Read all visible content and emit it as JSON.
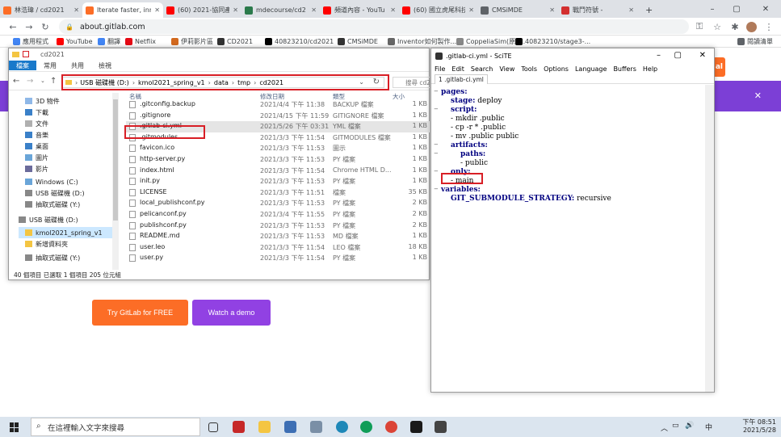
{
  "browser": {
    "tabs": [
      {
        "label": "林浩瑋 / cd2021",
        "icon": "gitlab-icon",
        "color": "#fc6d26"
      },
      {
        "label": "Iterate faster, inn",
        "icon": "gitlab-icon",
        "color": "#fc6d26"
      },
      {
        "label": "(60) 2021-協同產",
        "icon": "youtube-icon",
        "color": "#ff0000"
      },
      {
        "label": "mdecourse/cd2",
        "icon": "github-repo-icon",
        "color": "#2b7a4b"
      },
      {
        "label": "頻道內容 - YouTu",
        "icon": "youtube-icon",
        "color": "#ff0000"
      },
      {
        "label": "(60) 國立虎尾科技",
        "icon": "youtube-icon",
        "color": "#ff0000"
      },
      {
        "label": "CMSiMDE",
        "icon": "globe-icon",
        "color": "#5f6368"
      },
      {
        "label": "戰鬥符號 - ",
        "icon": "bookmark-icon",
        "color": "#d32f2f"
      }
    ],
    "new_tab": "+",
    "url": "about.gitlab.com",
    "bookmarks": [
      {
        "label": "應用程式",
        "color": "#4285f4"
      },
      {
        "label": "YouTube",
        "color": "#ff0000"
      },
      {
        "label": "翻譯",
        "color": "#4285f4"
      },
      {
        "label": "Netflix",
        "color": "#e50914"
      },
      {
        "label": "伊莉影片區",
        "color": "#d2691e"
      },
      {
        "label": "CD2021",
        "color": "#333333"
      },
      {
        "label": "40823210/cd2021",
        "color": "#000000"
      },
      {
        "label": "CMSiMDE",
        "color": "#333333"
      },
      {
        "label": "Inventor如何製作...",
        "color": "#666666"
      },
      {
        "label": "CoppeliaSim(原V...",
        "color": "#888888"
      },
      {
        "label": "40823210/stage3-...",
        "color": "#000000"
      },
      {
        "label": "閱讀清單",
        "color": "#5f6368"
      }
    ],
    "orange_btn_label": "al",
    "purple_bar_close": "✕"
  },
  "gitlab": {
    "try_button": "Try GitLab for FREE",
    "demo_button": "Watch a demo"
  },
  "explorer": {
    "title": "cd2021",
    "ribbon": [
      "檔案",
      "常用",
      "共用",
      "檢視"
    ],
    "breadcrumb": [
      "USB 磁碟機 (D:)",
      "kmol2021_spring_v1",
      "data",
      "tmp",
      "cd2021"
    ],
    "search_placeholder": "搜尋 cd2021",
    "columns": {
      "name": "名稱",
      "date": "修改日期",
      "type": "類型",
      "size": "大小"
    },
    "tree": [
      {
        "label": "3D 物件",
        "color": "#8fb8e8"
      },
      {
        "label": "下載",
        "color": "#3a80c8"
      },
      {
        "label": "文件",
        "color": "#b0b0b0"
      },
      {
        "label": "音樂",
        "color": "#3a80c8"
      },
      {
        "label": "桌面",
        "color": "#3a80c8"
      },
      {
        "label": "圖片",
        "color": "#6aa5d8"
      },
      {
        "label": "影片",
        "color": "#6b6b9b"
      },
      {
        "label": "Windows (C:)",
        "color": "#6aa5d8"
      },
      {
        "label": "USB 磁碟機 (D:)",
        "color": "#888888"
      },
      {
        "label": "抽取式磁碟 (Y:)",
        "color": "#888888"
      },
      {
        "label": "USB 磁碟機 (D:)",
        "color": "#888888"
      },
      {
        "label": "kmol2021_spring_v1",
        "color": "#f4c542"
      },
      {
        "label": "新增資料夾",
        "color": "#f4c542"
      },
      {
        "label": "抽取式磁碟 (Y:)",
        "color": "#888888"
      }
    ],
    "files": [
      {
        "name": ".gitconfig.backup",
        "date": "2021/4/4 下午 11:38",
        "type": "BACKUP 檔案",
        "size": "1 KB"
      },
      {
        "name": ".gitignore",
        "date": "2021/4/15 下午 11:59",
        "type": "GITIGNORE 檔案",
        "size": "1 KB"
      },
      {
        "name": ".gitlab-ci.yml",
        "date": "2021/5/26 下午 03:31",
        "type": "YML 檔案",
        "size": "1 KB"
      },
      {
        "name": ".gitmodules",
        "date": "2021/3/3 下午 11:54",
        "type": "GITMODULES 檔案",
        "size": "1 KB"
      },
      {
        "name": "favicon.ico",
        "date": "2021/3/3 下午 11:53",
        "type": "圖示",
        "size": "1 KB"
      },
      {
        "name": "http-server.py",
        "date": "2021/3/3 下午 11:53",
        "type": "PY 檔案",
        "size": "1 KB"
      },
      {
        "name": "index.html",
        "date": "2021/3/3 下午 11:54",
        "type": "Chrome HTML D...",
        "size": "1 KB"
      },
      {
        "name": "init.py",
        "date": "2021/3/3 下午 11:53",
        "type": "PY 檔案",
        "size": "1 KB"
      },
      {
        "name": "LICENSE",
        "date": "2021/3/3 下午 11:51",
        "type": "檔案",
        "size": "35 KB"
      },
      {
        "name": "local_publishconf.py",
        "date": "2021/3/3 下午 11:53",
        "type": "PY 檔案",
        "size": "2 KB"
      },
      {
        "name": "pelicanconf.py",
        "date": "2021/3/4 下午 11:55",
        "type": "PY 檔案",
        "size": "2 KB"
      },
      {
        "name": "publishconf.py",
        "date": "2021/3/3 下午 11:53",
        "type": "PY 檔案",
        "size": "2 KB"
      },
      {
        "name": "README.md",
        "date": "2021/3/3 下午 11:53",
        "type": "MD 檔案",
        "size": "1 KB"
      },
      {
        "name": "user.leo",
        "date": "2021/3/3 下午 11:54",
        "type": "LEO 檔案",
        "size": "18 KB"
      },
      {
        "name": "user.py",
        "date": "2021/3/3 下午 11:54",
        "type": "PY 檔案",
        "size": "1 KB"
      }
    ],
    "status": "40 個項目    已選取 1 個項目  205 位元組"
  },
  "scite": {
    "title": ".gitlab-ci.yml - SciTE",
    "menu": [
      "File",
      "Edit",
      "Search",
      "View",
      "Tools",
      "Options",
      "Language",
      "Buffers",
      "Help"
    ],
    "tab": "1 .gitlab-ci.yml",
    "lines": [
      {
        "key": "pages:",
        "val": "",
        "indent": 0
      },
      {
        "key": "stage:",
        "val": " deploy",
        "indent": 1
      },
      {
        "key": "script:",
        "val": "",
        "indent": 1
      },
      {
        "key": "",
        "val": "- mkdir .public",
        "indent": 1
      },
      {
        "key": "",
        "val": "- cp -r * .public",
        "indent": 1
      },
      {
        "key": "",
        "val": "- mv .public public",
        "indent": 1
      },
      {
        "key": "artifacts:",
        "val": "",
        "indent": 1
      },
      {
        "key": "paths:",
        "val": "",
        "indent": 2
      },
      {
        "key": "",
        "val": "- public",
        "indent": 2
      },
      {
        "key": "only:",
        "val": "",
        "indent": 1
      },
      {
        "key": "",
        "val": "- main",
        "indent": 1
      },
      {
        "key": "variables:",
        "val": "",
        "indent": 0
      },
      {
        "key": "GIT_SUBMODULE_STRATEGY:",
        "val": " recursive",
        "indent": 1
      }
    ]
  },
  "taskbar": {
    "search_placeholder": "在這裡輸入文字來搜尋",
    "time": "下午 08:51",
    "date": "2021/5/28",
    "lang": "中"
  },
  "colors": {
    "highlight_red": "#d81f26",
    "gitlab_orange": "#fc6d26",
    "gitlab_purple": "#9141e3"
  }
}
